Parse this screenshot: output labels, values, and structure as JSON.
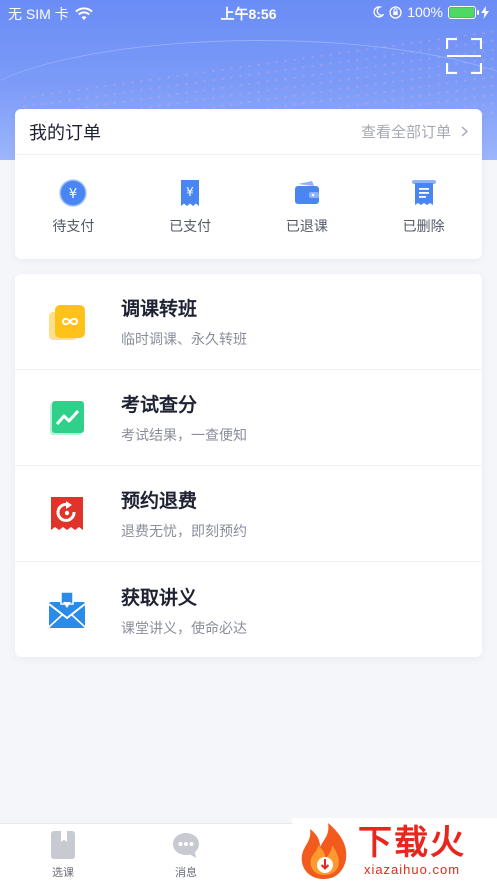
{
  "status_bar": {
    "carrier": "无 SIM 卡",
    "time": "上午8:56",
    "battery": "100%"
  },
  "orders": {
    "title": "我的订单",
    "view_all": "查看全部订单",
    "items": [
      {
        "label": "待支付",
        "icon": "yen-coin-icon"
      },
      {
        "label": "已支付",
        "icon": "yen-receipt-icon"
      },
      {
        "label": "已退课",
        "icon": "wallet-icon"
      },
      {
        "label": "已删除",
        "icon": "document-icon"
      }
    ]
  },
  "menu": [
    {
      "title": "调课转班",
      "subtitle": "临时调课、永久转班",
      "icon": "infinity-card-icon"
    },
    {
      "title": "考试查分",
      "subtitle": "考试结果，一查便知",
      "icon": "trend-chart-icon"
    },
    {
      "title": "预约退费",
      "subtitle": "退费无忧，即刻预约",
      "icon": "refund-icon"
    },
    {
      "title": "获取讲义",
      "subtitle": "课堂讲义，使命必达",
      "icon": "download-envelope-icon"
    }
  ],
  "tabs": [
    {
      "label": "选课",
      "icon": "book-icon"
    },
    {
      "label": "消息",
      "icon": "chat-bubble-icon"
    }
  ],
  "watermark": {
    "text": "下载火",
    "url": "xiazaihuo.com"
  },
  "colors": {
    "accent": "#4a7cf3",
    "hero_top": "#6a8cf5",
    "watermark_red": "#e8261d"
  }
}
